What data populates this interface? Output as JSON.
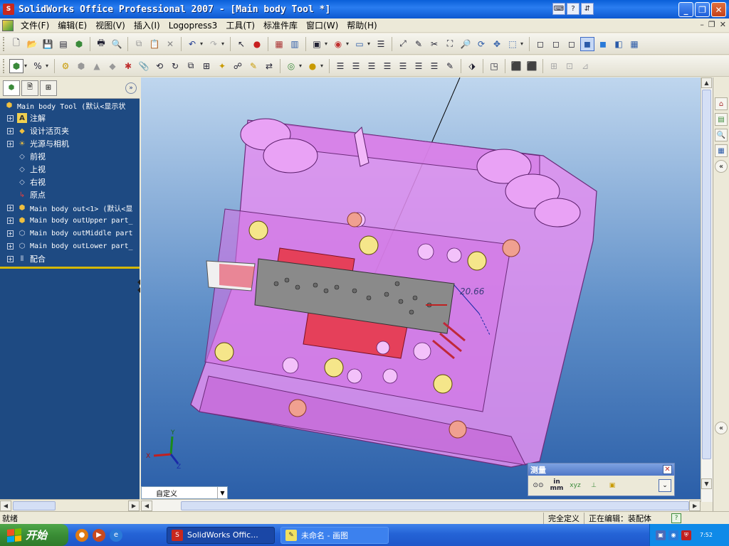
{
  "window": {
    "title": "SolidWorks Office Professional 2007 - [Main body Tool *]",
    "icon": "solidworks-logo-icon",
    "min_label": "_",
    "restore_label": "❐",
    "close_label": "✕"
  },
  "menubar": {
    "items": [
      "文件(F)",
      "编辑(E)",
      "视图(V)",
      "插入(I)",
      "Logopress3",
      "工具(T)",
      "标准件库",
      "窗口(W)",
      "帮助(H)"
    ]
  },
  "feature_tree": {
    "items": [
      {
        "label": "Main body Tool  (默认<显示状",
        "icon": "assembly-icon",
        "expander": ""
      },
      {
        "label": "注解",
        "icon": "annotation-icon",
        "expander": "+"
      },
      {
        "label": "设计活页夹",
        "icon": "design-binder-icon",
        "expander": "+"
      },
      {
        "label": "光源与相机",
        "icon": "lights-cameras-icon",
        "expander": "+"
      },
      {
        "label": "前视",
        "icon": "plane-icon",
        "expander": ""
      },
      {
        "label": "上视",
        "icon": "plane-icon",
        "expander": ""
      },
      {
        "label": "右视",
        "icon": "plane-icon",
        "expander": ""
      },
      {
        "label": "原点",
        "icon": "origin-icon",
        "expander": ""
      },
      {
        "label": "Main body out<1> (默认<显",
        "icon": "part-icon",
        "expander": "+"
      },
      {
        "label": "Main body outUpper part_",
        "icon": "part-icon",
        "expander": "+"
      },
      {
        "label": "Main body outMiddle part",
        "icon": "part-icon",
        "expander": "+"
      },
      {
        "label": "Main body outLower part_",
        "icon": "part-icon",
        "expander": "+"
      },
      {
        "label": "配合",
        "icon": "mates-icon",
        "expander": "+"
      }
    ]
  },
  "viewport": {
    "dimension_label": "20.66",
    "triad": {
      "x": "X",
      "y": "Y",
      "z": "Z"
    },
    "view_orientation": "自定义"
  },
  "measure_toolbar": {
    "title": "测量",
    "close_label": "✕",
    "buttons": [
      "arc-circle-measure-icon",
      "units-precision-icon",
      "xyz-measure-icon",
      "point-to-point-icon",
      "create-sensor-icon"
    ],
    "unit_label_top": "in",
    "unit_label_bottom": "mm"
  },
  "statusbar": {
    "ready": "就绪",
    "definition": "完全定义",
    "editing": "正在编辑：装配体",
    "help": "?"
  },
  "taskbar": {
    "start_label": "开始",
    "tasks": [
      {
        "label": "SolidWorks Offic...",
        "icon": "solidworks-logo-icon",
        "active": true
      },
      {
        "label": "未命名 - 画图",
        "icon": "paint-icon",
        "active": false
      }
    ],
    "clock": "7:52"
  },
  "colors": {
    "titlebar": "#0a5fd8",
    "feature_tree_bg": "#1e4a82",
    "model_pink": "#e38ff0",
    "part_red": "#e5405a",
    "strip_gray": "#8a8a8a"
  }
}
